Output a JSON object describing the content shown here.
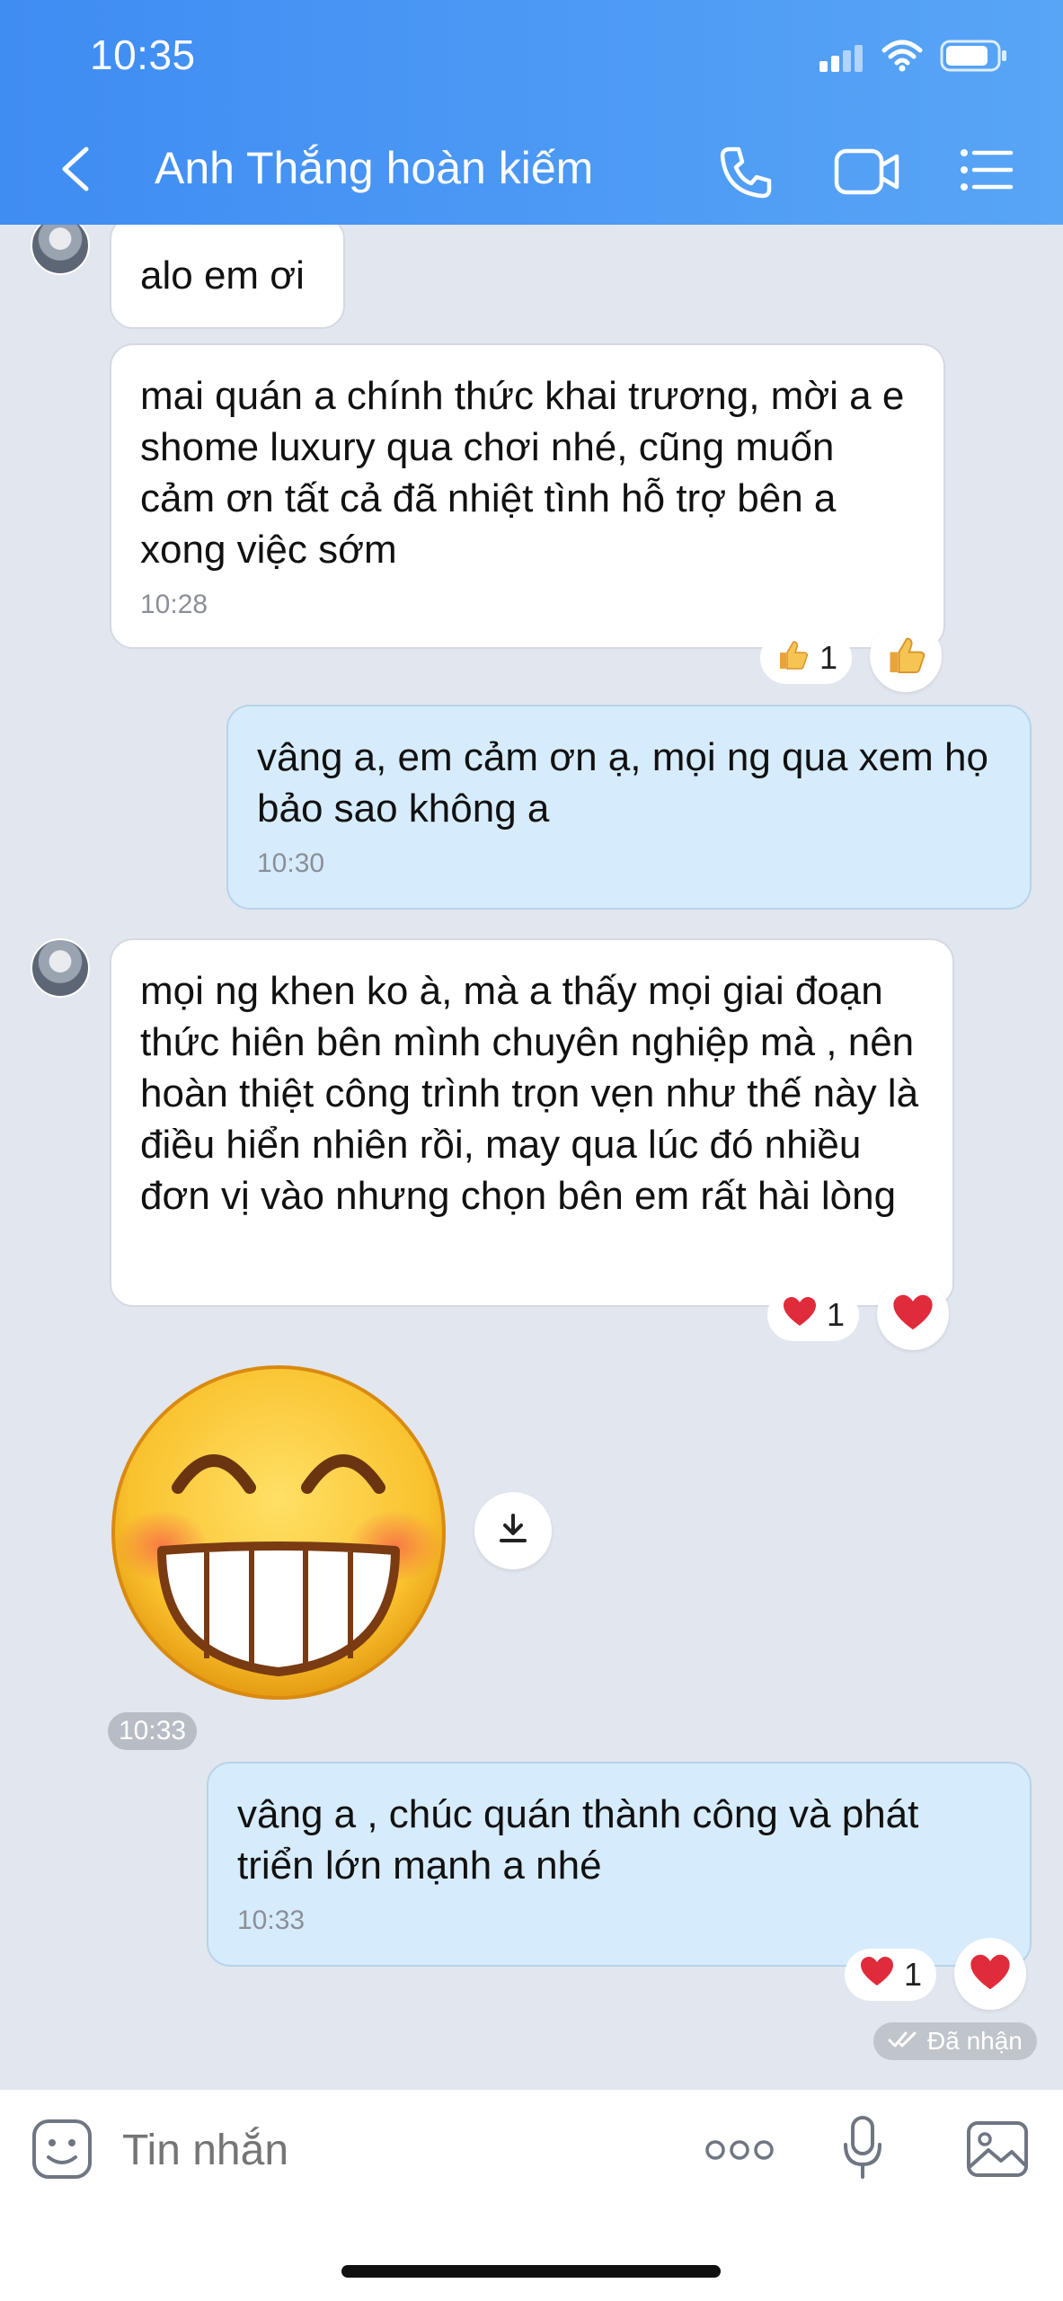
{
  "status_bar": {
    "time": "10:35"
  },
  "header": {
    "contact_name": "Anh Thắng hoàn kiếm"
  },
  "messages": [
    {
      "id": "m1",
      "text": "alo em ơi"
    },
    {
      "id": "m2",
      "text": "mai quán a chính thức khai trương, mời a e shome luxury qua chơi nhé, cũng muốn cảm ơn tất cả đã nhiệt tình hỗ trợ bên a xong việc sớm",
      "time": "10:28",
      "reaction": {
        "icon": "thumbs-up",
        "count": "1"
      }
    },
    {
      "id": "m3",
      "text": "vâng a, em cảm ơn ạ, mọi ng qua xem họ bảo sao không a",
      "time": "10:30"
    },
    {
      "id": "m4",
      "text": "mọi ng khen ko à, mà a thấy mọi giai đoạn thức hiên bên mình chuyên nghiệp mà , nên hoàn thiệt công trình trọn vẹn như thế này là điều hiển nhiên rồi, may qua lúc đó nhiều đơn vị vào nhưng chọn bên em rất hài lòng",
      "reaction": {
        "icon": "heart",
        "count": "1"
      }
    },
    {
      "id": "m5",
      "sticker": "grinning-emoji",
      "time": "10:33"
    },
    {
      "id": "m6",
      "text": "vâng a , chúc quán thành công và phát triển lớn mạnh a nhé",
      "time": "10:33",
      "reaction": {
        "icon": "heart",
        "count": "1"
      }
    }
  ],
  "status": {
    "seen_label": "Đã nhận"
  },
  "input": {
    "placeholder": "Tin nhắn"
  },
  "colors": {
    "header_start": "#3f8cf3",
    "header_end": "#58a5f6",
    "sent_bubble": "#d6ecfd",
    "received_bubble": "#ffffff",
    "background": "#e2e6ee"
  }
}
